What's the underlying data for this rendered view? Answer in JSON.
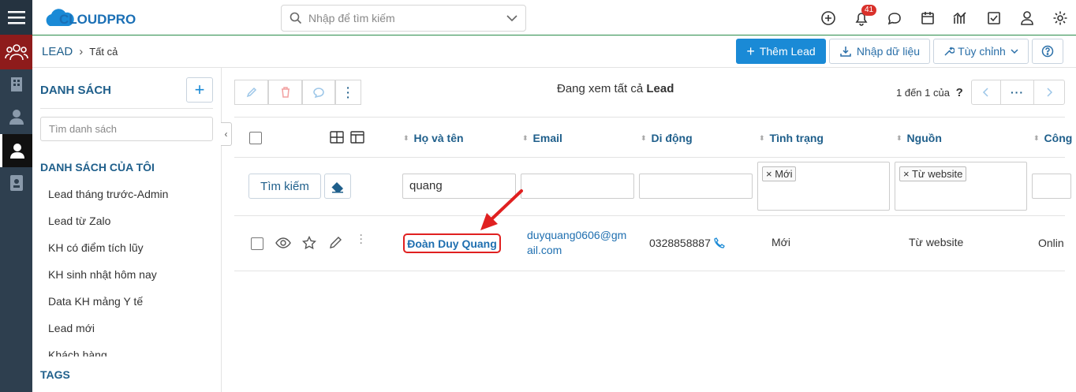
{
  "app": {
    "logo_text": "CLOUDPRO",
    "notification_count": "41"
  },
  "search": {
    "placeholder": "Nhập để tìm kiếm"
  },
  "breadcrumb": {
    "module": "LEAD",
    "current": "Tất cả"
  },
  "actions": {
    "add": "Thêm Lead",
    "import": "Nhập dữ liệu",
    "customize": "Tùy chỉnh"
  },
  "sidebar": {
    "list_title": "DANH SÁCH",
    "list_search_placeholder": "Tìm danh sách",
    "my_lists_title": "DANH SÁCH CỦA TÔI",
    "items": [
      "Lead tháng trước-Admin",
      "Lead từ Zalo",
      "KH có điểm tích lũy",
      "KH sinh nhật hôm nay",
      "Data KH mảng Y tế",
      "Lead mới",
      "Khách hàng"
    ],
    "tags_title": "TAGS"
  },
  "list": {
    "viewing_prefix": "Đang xem tất cả",
    "viewing_module": "Lead",
    "pagination": "1 đến 1 của",
    "pagination_help": "?",
    "columns": [
      "Họ và tên",
      "Email",
      "Di động",
      "Tình trạng",
      "Nguồn",
      "Công"
    ],
    "filters": {
      "search_button": "Tìm kiếm",
      "name": "quang",
      "status_tag": "Mới",
      "source_tag": "Từ website"
    },
    "rows": [
      {
        "name": "Đoàn Duy Quang",
        "email_line1": "duyquang0606@gm",
        "email_line2": "ail.com",
        "mobile": "0328858887",
        "status": "Mới",
        "source": "Từ website",
        "extra": "Onlin"
      }
    ]
  },
  "colors": {
    "accent": "#1a8ad6",
    "header_text": "#1f5f8b",
    "highlight": "#e02020",
    "rail": "#2e3f4f"
  }
}
